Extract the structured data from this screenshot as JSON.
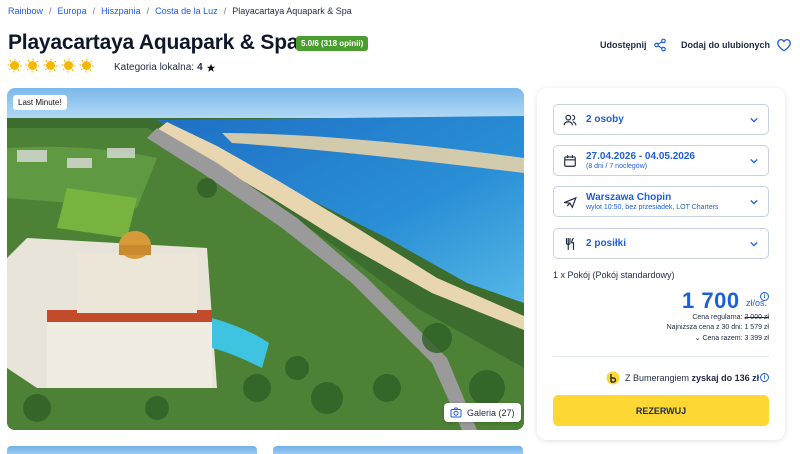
{
  "breadcrumb": {
    "items": [
      "Rainbow",
      "Europa",
      "Hiszpania",
      "Costa de la Luz"
    ],
    "current": "Playacartaya Aquapark & Spa",
    "separator": "/"
  },
  "hotel": {
    "name": "Playacartaya Aquapark & Spa",
    "rating_badge": "5.0/6 (318 opinii)",
    "stars_count": 5,
    "local_category_label": "Kategoria lokalna:",
    "local_category_value": "4"
  },
  "actions": {
    "share_label": "Udostępnij",
    "favorite_label": "Dodaj do ulubionych"
  },
  "hero": {
    "badge": "Last Minute!",
    "gallery_label": "Galeria (27)"
  },
  "booking": {
    "guests": {
      "label": "2 osoby"
    },
    "dates": {
      "label": "27.04.2026 - 04.05.2026",
      "sub": "(8 dni / 7 noclegów)"
    },
    "flight": {
      "label": "Warszawa Chopin",
      "sub": "wylot 10:50, bez przesiadek, LOT Charters"
    },
    "meals": {
      "label": "2 posiłki"
    },
    "room": "1 x Pokój  (Pokój standardowy)",
    "price": "1 700",
    "price_unit": "zł/os.",
    "regular_label": "Cena regularna:",
    "regular_value": "2 000 zł",
    "lowest_label": "Najniższa cena z 30 dni:",
    "lowest_value": "1 579 zł",
    "total_label": "Cena razem:",
    "total_value": "3 399 zł",
    "bumerang_prefix": "Z Bumerangiem",
    "bumerang_bold": "zyskaj do 136 zł",
    "reserve_label": "REZERWUJ"
  },
  "colors": {
    "accent": "#1d5fd8",
    "rating_green": "#4a9d2e",
    "sun": "#f5b800",
    "reserve_yellow": "#fdd835"
  }
}
